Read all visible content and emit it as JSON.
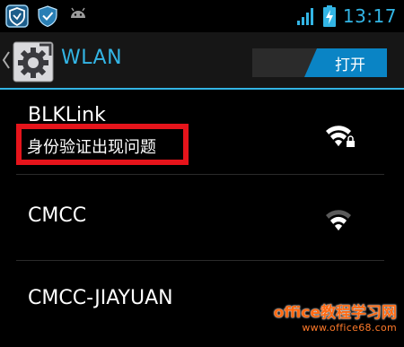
{
  "status_bar": {
    "time": "13:17",
    "left_icons": [
      "shield-notification-icon",
      "shield-check-icon",
      "android-icon"
    ],
    "right_icons": [
      "signal-icon",
      "battery-charging-icon"
    ]
  },
  "action_bar": {
    "title": "WLAN",
    "toggle_label": "打开",
    "accent_color": "#33b5e5"
  },
  "networks": [
    {
      "ssid": "BLKLink",
      "status": "身份验证出现问题",
      "secured": true,
      "signal": "strong"
    },
    {
      "ssid": "CMCC",
      "status": "",
      "secured": false,
      "signal": "medium"
    },
    {
      "ssid": "CMCC-JIAYUAN",
      "status": "",
      "secured": false,
      "signal": ""
    }
  ],
  "watermark": {
    "brand": "office教程学习网",
    "url": "www.office68.com"
  }
}
